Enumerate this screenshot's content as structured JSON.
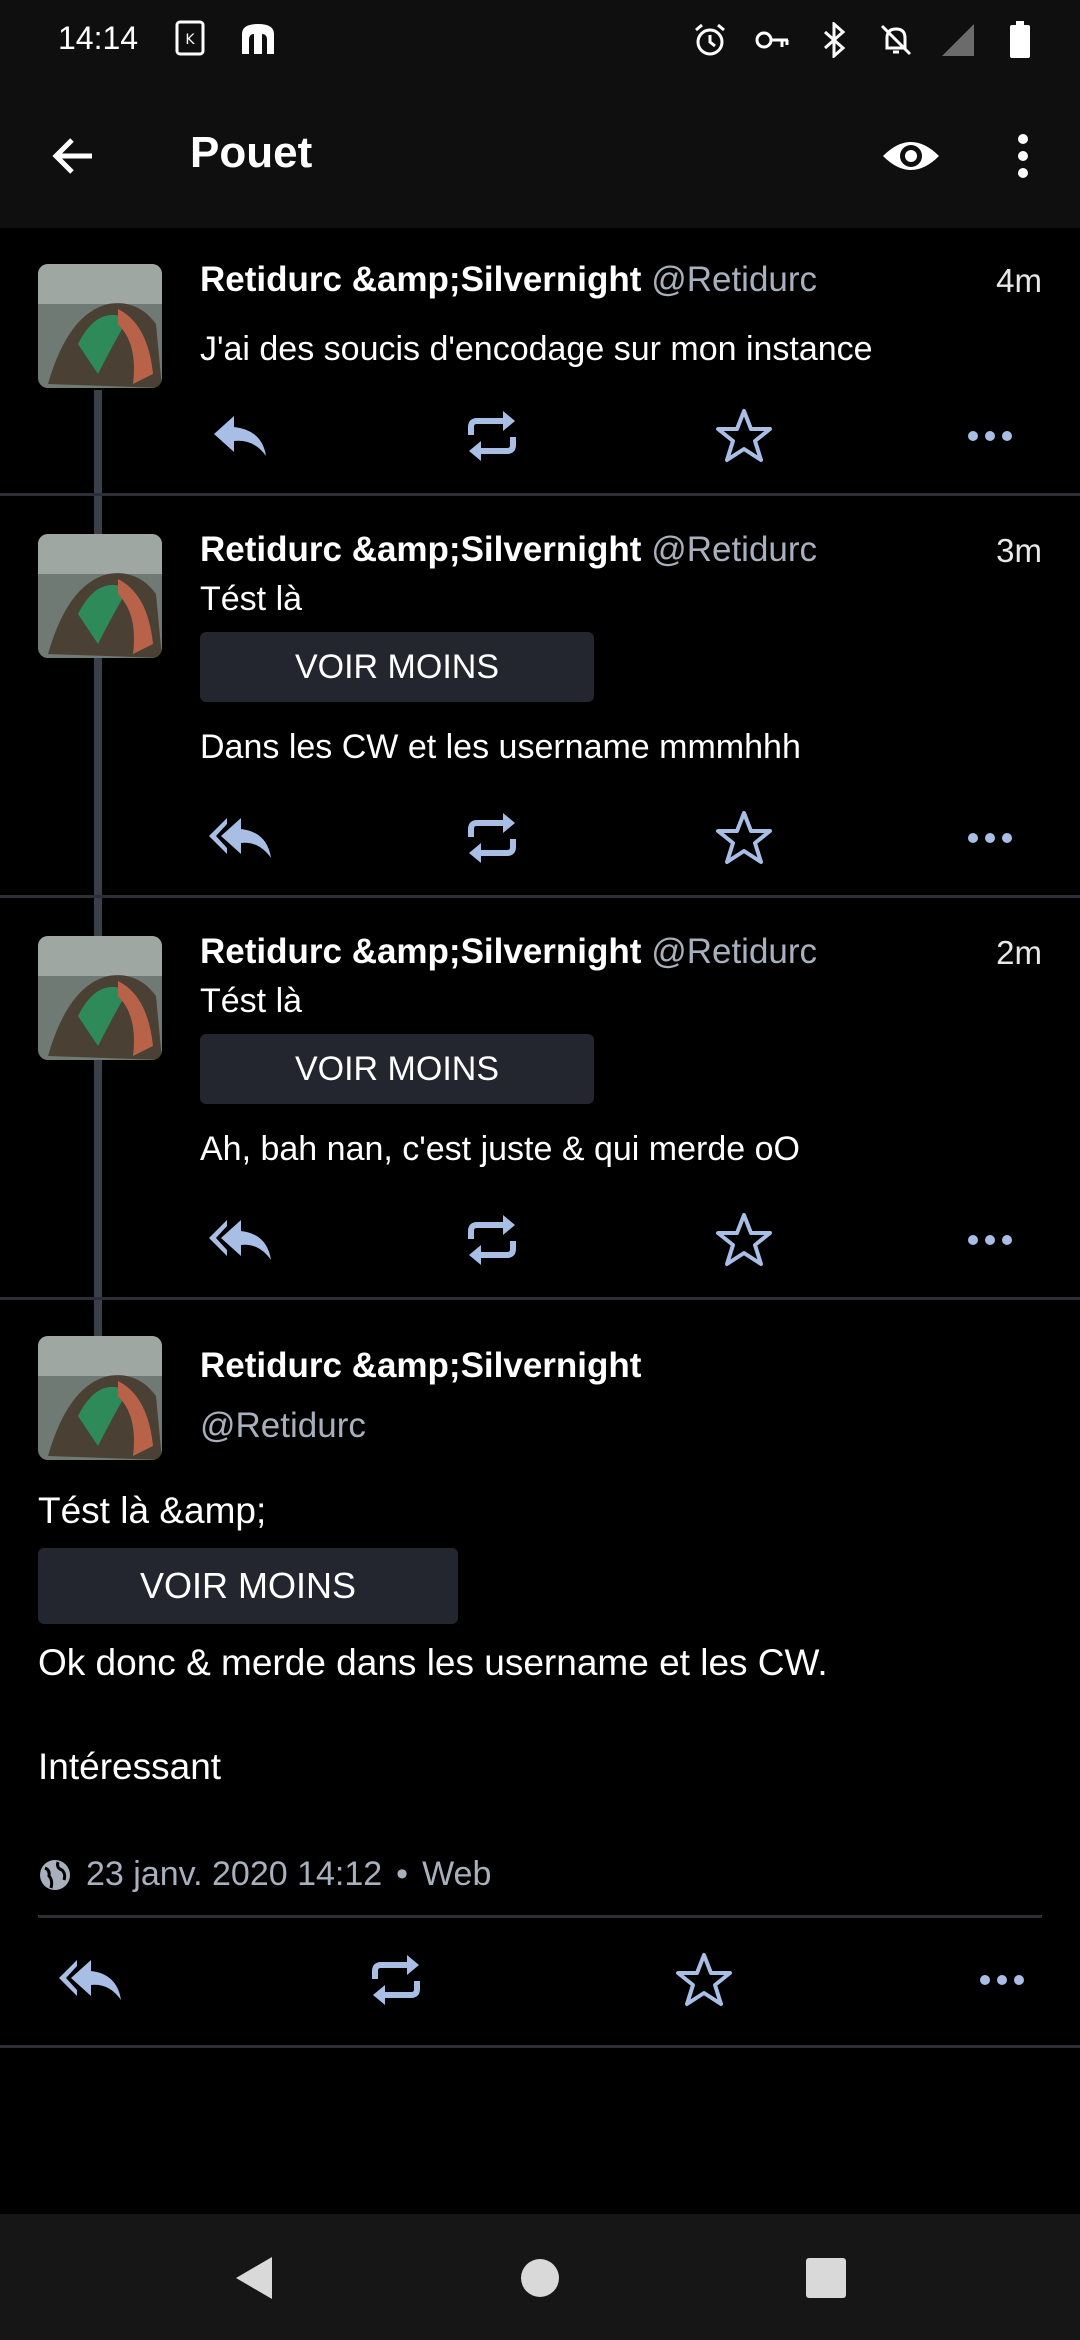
{
  "status_bar": {
    "time": "14:14",
    "left_icons": [
      "k-app-icon",
      "tusky-elephant-icon"
    ],
    "right_icons": [
      "alarm-icon",
      "vpn-key-icon",
      "bluetooth-icon",
      "notifications-off-icon",
      "signal-icon",
      "battery-icon"
    ]
  },
  "toolbar": {
    "title": "Pouet",
    "back_icon": "arrow-back-icon",
    "eye_icon": "eye-icon",
    "more_icon": "more-vert-icon"
  },
  "colors": {
    "background": "#000000",
    "bar": "#0f0f0f",
    "action_icon": "#a9bee5",
    "cw_button": "#23262e",
    "secondary_text": "#a9b0bd",
    "thread_line": "#3b3f4a"
  },
  "posts": [
    {
      "name": "Retidurc &amp;Silvernight",
      "handle": "@Retidurc",
      "time": "4m",
      "spoiler": "",
      "content": "J'ai des soucis d'encodage sur mon instance",
      "reply_type": "reply"
    },
    {
      "name": "Retidurc &amp;Silvernight",
      "handle": "@Retidurc",
      "time": "3m",
      "spoiler": "Tést là",
      "cw_label": "VOIR MOINS",
      "content": "Dans les CW et les username mmmhhh",
      "reply_type": "reply-all"
    },
    {
      "name": "Retidurc &amp;Silvernight",
      "handle": "@Retidurc",
      "time": "2m",
      "spoiler": "Tést là",
      "cw_label": "VOIR MOINS",
      "content": "Ah, bah nan, c'est juste & qui merde oO",
      "reply_type": "reply-all"
    }
  ],
  "detail": {
    "name": "Retidurc &amp;Silvernight",
    "handle": "@Retidurc",
    "spoiler": "Tést là &amp;",
    "cw_label": "VOIR MOINS",
    "content_line1": "Ok donc & merde dans les username et les CW.",
    "content_line2": "Intéressant",
    "timestamp": "23 janv. 2020 14:12",
    "separator": "•",
    "source": "Web"
  },
  "nav": {
    "back": "nav-back-icon",
    "home": "nav-home-icon",
    "recents": "nav-recents-icon"
  }
}
